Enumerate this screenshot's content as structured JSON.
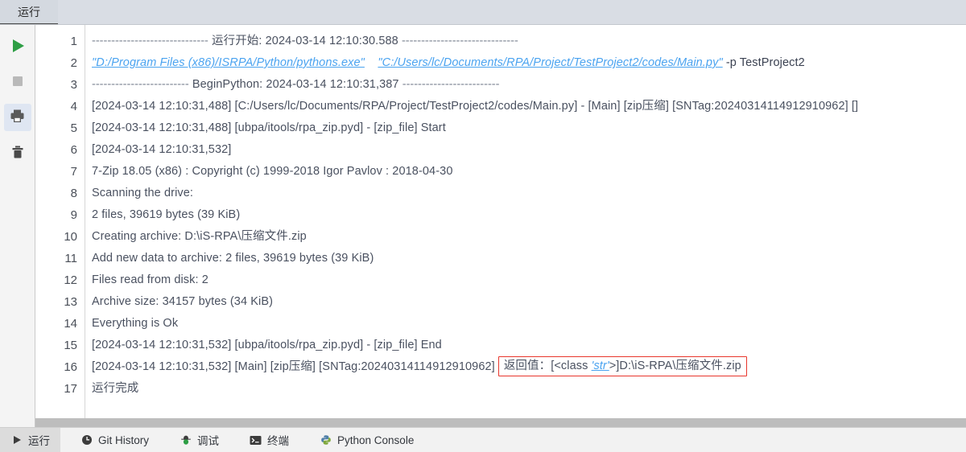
{
  "window": {
    "tabs": [
      {
        "label": "运行",
        "active": true
      }
    ]
  },
  "left_toolbar": {
    "buttons": [
      {
        "name": "run-button",
        "icon": "play-icon",
        "label": "运行",
        "selected": false
      },
      {
        "name": "stop-button",
        "icon": "stop-icon",
        "label": "停止",
        "selected": false
      },
      {
        "name": "print-button",
        "icon": "printer-icon",
        "label": "打印",
        "selected": true
      },
      {
        "name": "clear-button",
        "icon": "trash-icon",
        "label": "清空",
        "selected": false
      }
    ]
  },
  "console": {
    "line_numbers": [
      "1",
      "2",
      "3",
      "4",
      "5",
      "6",
      "7",
      "8",
      "9",
      "10",
      "11",
      "12",
      "13",
      "14",
      "15",
      "16",
      "17"
    ],
    "lines": [
      {
        "n": "1",
        "type": "separator",
        "dash_left": "------------------------------",
        "text": " 运行开始: 2024-03-14 12:10:30.588 ",
        "dash_right": "------------------------------"
      },
      {
        "n": "2",
        "type": "links",
        "link1": "\"D:/Program Files (x86)/ISRPA/Python/pythons.exe\"",
        "link2": "\"C:/Users/lc/Documents/RPA/Project/TestProject2/codes/Main.py\"",
        "tail": " -p  TestProject2"
      },
      {
        "n": "3",
        "type": "separator",
        "dash_left": "-------------------------",
        "text": " BeginPython: 2024-03-14 12:10:31,387 ",
        "dash_right": "-------------------------"
      },
      {
        "n": "4",
        "type": "plain",
        "text": "[2024-03-14 12:10:31,488] [C:/Users/lc/Documents/RPA/Project/TestProject2/codes/Main.py] - [Main] [zip压缩] [SNTag:20240314114912910962] []"
      },
      {
        "n": "5",
        "type": "plain",
        "text": "[2024-03-14 12:10:31,488] [ubpa/itools/rpa_zip.pyd] - [zip_file] Start"
      },
      {
        "n": "6",
        "type": "plain",
        "text": "[2024-03-14 12:10:31,532]"
      },
      {
        "n": "7",
        "type": "plain",
        "text": "7-Zip 18.05 (x86) : Copyright (c) 1999-2018 Igor Pavlov : 2018-04-30"
      },
      {
        "n": "8",
        "type": "plain",
        "text": "Scanning the drive:"
      },
      {
        "n": "9",
        "type": "plain",
        "text": "2 files, 39619 bytes (39 KiB)"
      },
      {
        "n": "10",
        "type": "plain",
        "text": "Creating archive: D:\\iS-RPA\\压缩文件.zip"
      },
      {
        "n": "11",
        "type": "plain",
        "text": "Add new data to archive: 2 files, 39619 bytes (39 KiB)"
      },
      {
        "n": "12",
        "type": "plain",
        "text": "Files read from disk: 2"
      },
      {
        "n": "13",
        "type": "plain",
        "text": "Archive size: 34157 bytes (34 KiB)"
      },
      {
        "n": "14",
        "type": "plain",
        "text": "Everything is Ok"
      },
      {
        "n": "15",
        "type": "plain",
        "text": "[2024-03-14 12:10:31,532] [ubpa/itools/rpa_zip.pyd] - [zip_file] End"
      },
      {
        "n": "16",
        "type": "highlighted",
        "prefix": "[2024-03-14 12:10:31,532] [Main] [zip压缩] [SNTag:20240314114912910962]",
        "box_before": "返回值：[<class ",
        "box_class": "'str'",
        "box_after": ">]D:\\iS-RPA\\压缩文件.zip"
      },
      {
        "n": "17",
        "type": "plain",
        "text": "运行完成"
      }
    ]
  },
  "statusbar": {
    "items": [
      {
        "label": "运行",
        "icon": "play-icon",
        "active": true
      },
      {
        "label": "Git History",
        "icon": "clock-icon",
        "active": false
      },
      {
        "label": "调试",
        "icon": "bug-icon",
        "active": false
      },
      {
        "label": "终端",
        "icon": "terminal-icon",
        "active": false
      },
      {
        "label": "Python Console",
        "icon": "python-icon",
        "active": false
      }
    ]
  },
  "colors": {
    "link": "#4aa3f0",
    "highlight_border": "#e8362c",
    "tab_bg": "#d9dde4",
    "run_green": "#2e9e45",
    "text": "#4a5160"
  }
}
